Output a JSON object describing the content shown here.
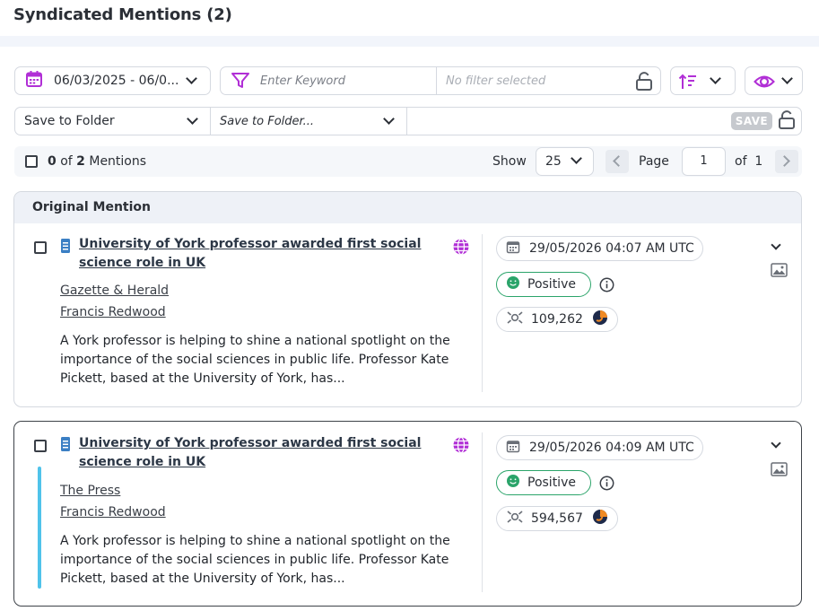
{
  "header": {
    "title": "Syndicated Mentions (2)"
  },
  "toolbar": {
    "date_range": "06/03/2025 - 06/0...",
    "keyword_placeholder": "Enter Keyword",
    "filter_status": "No filter selected",
    "folder_select": "Save to Folder",
    "folder_select_secondary": "Save to Folder...",
    "save_label": "SAVE"
  },
  "list_controls": {
    "selected": "0",
    "of_word": "of",
    "total": "2",
    "mentions_word": "Mentions",
    "show_label": "Show",
    "page_size": "25",
    "page_label": "Page",
    "page_value": "1",
    "of_label": "of",
    "page_total": "1"
  },
  "section": {
    "original_label": "Original Mention"
  },
  "mentions": [
    {
      "title": "University of York professor awarded first social science role in UK",
      "source": "Gazette & Herald",
      "author": "Francis Redwood",
      "description": "A York professor is helping to shine a national spotlight on the importance of the social sciences in public life. Professor Kate Pickett, based at the University of York, has...",
      "datetime": "29/05/2026 04:07 AM UTC",
      "sentiment": "Positive",
      "reach": "109,262"
    },
    {
      "title": "University of York professor awarded first social science role in UK",
      "source": "The Press",
      "author": "Francis Redwood",
      "description": "A York professor is helping to shine a national spotlight on the importance of the social sciences in public life. Professor Kate Pickett, based at the University of York, has...",
      "datetime": "29/05/2026 04:09 AM UTC",
      "sentiment": "Positive",
      "reach": "594,567"
    }
  ],
  "colors": {
    "accent_purple": "#b12fd6",
    "positive_green": "#2ba46a",
    "selected_bar": "#4fc3ea"
  }
}
